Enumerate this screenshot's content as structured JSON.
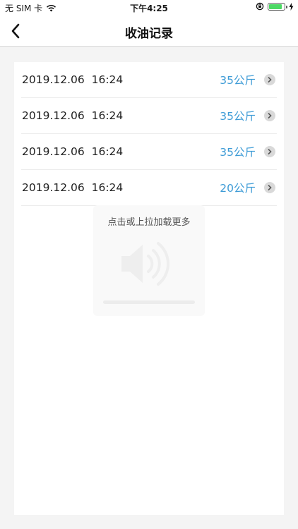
{
  "status_bar": {
    "carrier": "无 SIM 卡",
    "time": "下午4:25",
    "battery_level": 0.85,
    "icons": [
      "wifi-icon",
      "orientation-lock-icon",
      "battery-icon",
      "charging-bolt-icon"
    ]
  },
  "nav": {
    "title": "收油记录",
    "back_icon": "chevron-left-icon"
  },
  "records": [
    {
      "datetime": "2019.12.06  16:24",
      "amount": "35公斤"
    },
    {
      "datetime": "2019.12.06  16:24",
      "amount": "35公斤"
    },
    {
      "datetime": "2019.12.06  16:24",
      "amount": "35公斤"
    },
    {
      "datetime": "2019.12.06  16:24",
      "amount": "20公斤"
    }
  ],
  "load_more": "点击或上拉加载更多",
  "colors": {
    "accent": "#3d9bd6",
    "background": "#f4f4f4",
    "card": "#ffffff"
  },
  "loading_progress": 0.0
}
